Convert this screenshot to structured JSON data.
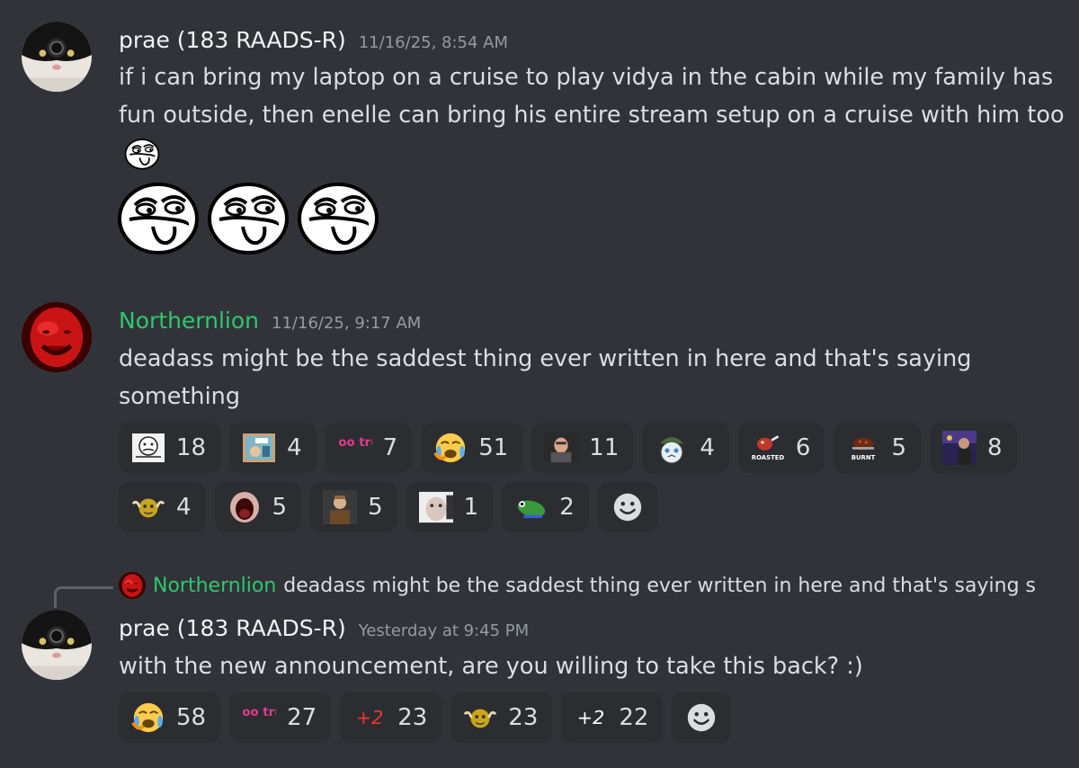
{
  "messages": [
    {
      "username": "prae (183 RAADS-R)",
      "timestamp": "11/16/25, 8:54 AM",
      "text": "if i can bring my laptop on a cruise to play vidya in the cabin while my family has fun outside, then enelle can bring his entire stream setup on a cruise with him too",
      "inline_emoji": "smug-pepe-face-emoji",
      "big_emojis": [
        "smug-face-emoji",
        "smug-face-emoji",
        "smug-face-emoji"
      ]
    },
    {
      "username": "Northernlion",
      "username_color": "#2dc770",
      "timestamp": "11/16/25, 9:17 AM",
      "text": "deadass might be the saddest thing ever written in here and that's saying something",
      "reactions": [
        {
          "emoji": "rage-comic-emoji",
          "count": "18"
        },
        {
          "emoji": "real-comic-emoji",
          "count": "4"
        },
        {
          "emoji": "sooo-true-emoji",
          "label": "sooo true",
          "count": "7"
        },
        {
          "emoji": "crying-face-emoji",
          "count": "51"
        },
        {
          "emoji": "streamer-face-emoji",
          "count": "11"
        },
        {
          "emoji": "soldier-cat-emoji",
          "count": "4"
        },
        {
          "emoji": "roasted-meat-emoji",
          "label": "ROASTED",
          "count": "6"
        },
        {
          "emoji": "burnt-turkey-emoji",
          "label": "BURNT",
          "count": "5"
        },
        {
          "emoji": "concert-photo-emoji",
          "count": "8"
        },
        {
          "emoji": "flexing-face-emoji",
          "count": "4"
        },
        {
          "emoji": "screaming-mouth-emoji",
          "count": "5"
        },
        {
          "emoji": "man-portrait-emoji",
          "count": "5"
        },
        {
          "emoji": "blurry-face-emoji",
          "count": "1"
        },
        {
          "emoji": "frog-emoji",
          "count": "2"
        }
      ]
    },
    {
      "reply": {
        "username": "Northernlion",
        "text": "deadass might be the saddest thing ever written in here and that's saying s"
      },
      "username": "prae (183 RAADS-R)",
      "timestamp": "Yesterday at 9:45 PM",
      "text": "with the new announcement, are you willing to take this back? :)",
      "reactions": [
        {
          "emoji": "crying-face-emoji",
          "count": "58"
        },
        {
          "emoji": "sooo-true-emoji",
          "label": "sooo true",
          "count": "27"
        },
        {
          "emoji": "plus-two-red-emoji",
          "label": "+2",
          "count": "23"
        },
        {
          "emoji": "flexing-face-emoji",
          "count": "23"
        },
        {
          "emoji": "plus-two-white-emoji",
          "label": "+2",
          "count": "22"
        }
      ]
    }
  ],
  "colors": {
    "background": "#323339",
    "reaction_bg": "#2b2d31",
    "accent_green": "#2dc770",
    "timestamp": "#949ba4"
  }
}
